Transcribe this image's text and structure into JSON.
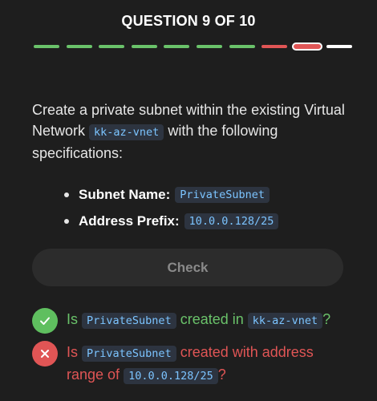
{
  "header": {
    "title": "QUESTION 9 OF 10"
  },
  "progress": {
    "total": 10,
    "current": 9,
    "segments": [
      "correct",
      "correct",
      "correct",
      "correct",
      "correct",
      "correct",
      "correct",
      "wrong",
      "current",
      "pending"
    ]
  },
  "question": {
    "line_before": "Create a private subnet within the existing Virtual Network",
    "vnet": "kk-az-vnet",
    "line_after": "with the following specifications:"
  },
  "specs": [
    {
      "label": "Subnet Name:",
      "value": "PrivateSubnet"
    },
    {
      "label": "Address Prefix:",
      "value": "10.0.0.128/25"
    }
  ],
  "check_button": {
    "label": "Check"
  },
  "results": [
    {
      "status": "pass",
      "pre": "Is",
      "code1": "PrivateSubnet",
      "mid": "created in",
      "code2": "kk-az-vnet",
      "post": "?"
    },
    {
      "status": "fail",
      "pre": "Is",
      "code1": "PrivateSubnet",
      "mid": "created with address range of",
      "code2": "10.0.0.128/25",
      "post": "?"
    }
  ],
  "colors": {
    "correct": "#6ac26a",
    "wrong": "#e05555",
    "code_text": "#7cc4ff",
    "code_bg": "#2d3440"
  },
  "icons": {
    "pass": "check-icon",
    "fail": "x-icon"
  }
}
